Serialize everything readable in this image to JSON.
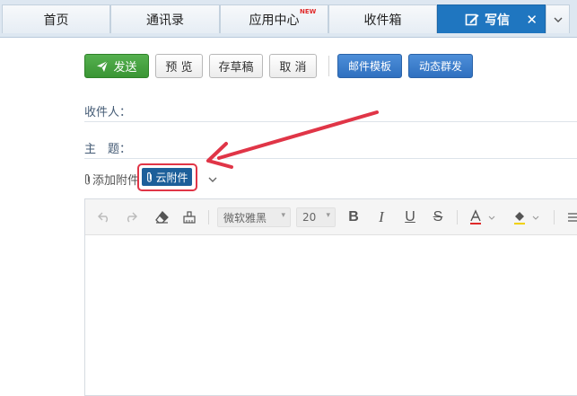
{
  "tabs": [
    {
      "label": "首页"
    },
    {
      "label": "通讯录"
    },
    {
      "label": "应用中心",
      "badge": "NEW"
    },
    {
      "label": "收件箱"
    },
    {
      "label": "写信",
      "active": true
    }
  ],
  "toolbar": {
    "send_label": "发送",
    "preview_label": "预 览",
    "save_draft_label": "存草稿",
    "cancel_label": "取 消",
    "template_label": "邮件模板",
    "group_send_label": "动态群发"
  },
  "fields": {
    "recipient_label": "收件人：",
    "subject_label": "主　题："
  },
  "attachments": {
    "add_label": "添加附件",
    "cloud_label": "云附件"
  },
  "editor": {
    "font_name": "微软雅黑",
    "font_size": "20"
  },
  "colors": {
    "tab_active": "#1f76c0",
    "send_green": "#3a9534",
    "blue_button": "#3479c8",
    "highlight_red": "#e03547"
  }
}
